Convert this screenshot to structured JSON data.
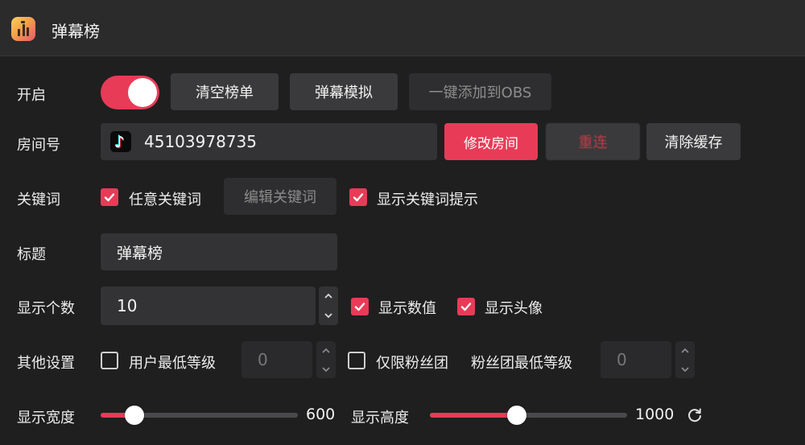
{
  "window": {
    "title": "弹幕榜"
  },
  "rows": {
    "enable": {
      "label": "开启",
      "toggle_on": true
    },
    "room": {
      "label": "房间号",
      "room_id": "45103978735"
    },
    "keyword": {
      "label": "关键词"
    },
    "title_row": {
      "label": "标题",
      "value": "弹幕榜"
    },
    "count": {
      "label": "显示个数",
      "value": "10"
    },
    "other": {
      "label": "其他设置",
      "user_min_level": "0",
      "fan_min_level": "0"
    },
    "width": {
      "label": "显示宽度",
      "value": "600",
      "level": 0.17
    },
    "height": {
      "label": "显示高度",
      "value": "1000",
      "level": 0.44
    }
  },
  "buttons": {
    "clear_rank": "清空榜单",
    "simulate": "弹幕模拟",
    "add_obs": "一键添加到OBS",
    "modify_room": "修改房间",
    "reconnect": "重连",
    "clear_cache": "清除缓存",
    "edit_keyword": "编辑关键词"
  },
  "checkboxes": {
    "any_keyword": {
      "label": "任意关键词",
      "checked": true
    },
    "show_keyword_tip": {
      "label": "显示关键词提示",
      "checked": true
    },
    "show_value": {
      "label": "显示数值",
      "checked": true
    },
    "show_avatar": {
      "label": "显示头像",
      "checked": true
    },
    "user_min_level": {
      "label": "用户最低等级",
      "checked": false
    },
    "fans_only": {
      "label": "仅限粉丝团",
      "checked": false
    }
  },
  "labels": {
    "fan_min_level": "粉丝团最低等级"
  },
  "icons": {
    "app": "chart-app-icon",
    "platform": "tiktok-icon",
    "reset": "refresh-icon"
  },
  "colors": {
    "accent": "#e83b57",
    "background": "#1f1f20",
    "control": "#3a3a3c"
  }
}
